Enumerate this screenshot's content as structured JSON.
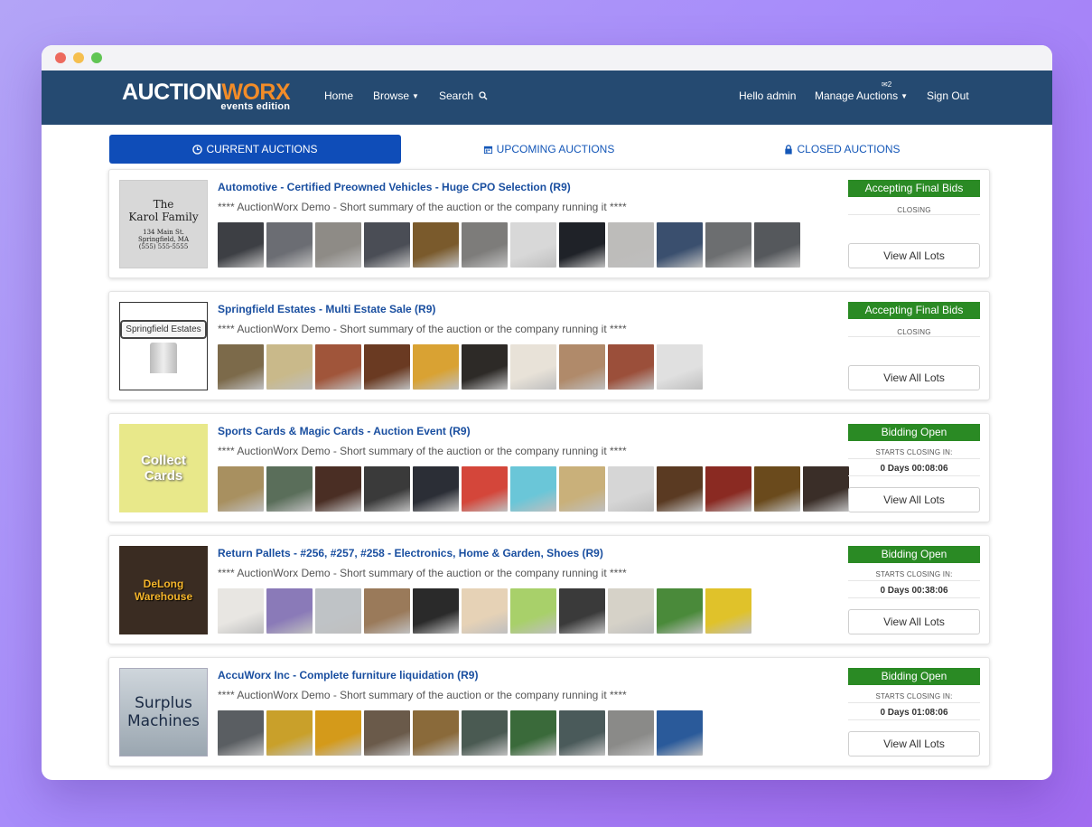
{
  "window_dots": [
    {
      "name": "close",
      "color": "#ed6a5e"
    },
    {
      "name": "minimize",
      "color": "#f5bf4f"
    },
    {
      "name": "maximize",
      "color": "#61c554"
    }
  ],
  "brand": {
    "word1": "AUCTION",
    "word2": "WORX",
    "subtitle": "events edition",
    "colors": {
      "navbar": "#254a71",
      "accent": "#f28c28"
    }
  },
  "nav": {
    "home": "Home",
    "browse": "Browse",
    "search": "Search",
    "greeting": "Hello admin",
    "manage": "Manage Auctions",
    "mail_count": "2",
    "signout": "Sign Out"
  },
  "tabs": {
    "current": "CURRENT AUCTIONS",
    "upcoming": "UPCOMING AUCTIONS",
    "closed": "CLOSED AUCTIONS"
  },
  "auctions": [
    {
      "title": "Automotive - Certified Preowned Vehicles - Huge CPO Selection (R9)",
      "summary": "**** AuctionWorx Demo - Short summary of the auction or the company running it ****",
      "status": "Accepting Final Bids",
      "status_sub": "CLOSING",
      "status_time": "",
      "view": "View All Lots",
      "thumb": {
        "line1": "The",
        "line2": "Karol Family",
        "line3": "134 Main St.",
        "line4": "Springfield, MA",
        "line5": "(555) 555-5555"
      },
      "lots": [
        "#3d3f44",
        "#6b6d73",
        "#8e8b86",
        "#4a4d55",
        "#7a5a2c",
        "#7d7c7a",
        "#d8d8d8",
        "#1f2228",
        "#bdbcba",
        "#3a4f6e",
        "#6c6e70",
        "#55585c"
      ]
    },
    {
      "title": "Springfield Estates - Multi Estate Sale (R9)",
      "summary": "**** AuctionWorx Demo - Short summary of the auction or the company running it ****",
      "status": "Accepting Final Bids",
      "status_sub": "CLOSING",
      "status_time": "",
      "view": "View All Lots",
      "thumb": {
        "line1": "Springfield Estates"
      },
      "lots": [
        "#7c6a4a",
        "#c9b98a",
        "#a0553a",
        "#6a3a22",
        "#d9a233",
        "#2d2a27",
        "#e8e2d8",
        "#b08a6a",
        "#9b4f3a",
        "#e0e0e0"
      ]
    },
    {
      "title": "Sports Cards & Magic Cards - Auction Event (R9)",
      "summary": "**** AuctionWorx Demo - Short summary of the auction or the company running it ****",
      "status": "Bidding Open",
      "status_sub": "STARTS CLOSING IN:",
      "status_time": "0 Days 00:08:06",
      "view": "View All Lots",
      "thumb": {
        "line1": "Collect",
        "line2": "Cards"
      },
      "lots": [
        "#a89060",
        "#5a6e5a",
        "#4a2e24",
        "#3a3a3a",
        "#2b2e36",
        "#d4463a",
        "#6ac6d8",
        "#c9b07a",
        "#d6d6d6",
        "#5a3a22",
        "#8a2a22",
        "#6a4a1c",
        "#3a2e28"
      ]
    },
    {
      "title": "Return Pallets - #256, #257, #258 - Electronics, Home & Garden, Shoes (R9)",
      "summary": "**** AuctionWorx Demo - Short summary of the auction or the company running it ****",
      "status": "Bidding Open",
      "status_sub": "STARTS CLOSING IN:",
      "status_time": "0 Days 00:38:06",
      "view": "View All Lots",
      "thumb": {
        "line1": "DeLong",
        "line2": "Warehouse"
      },
      "lots": [
        "#e8e6e2",
        "#8a7ab8",
        "#bfc3c6",
        "#9a7a5a",
        "#2a2a2a",
        "#e6d2b6",
        "#a8d06a",
        "#3a3a3a",
        "#d6d2c8",
        "#4a8a3a",
        "#e0c22a"
      ]
    },
    {
      "title": "AccuWorx Inc - Complete furniture liquidation (R9)",
      "summary": "**** AuctionWorx Demo - Short summary of the auction or the company running it ****",
      "status": "Bidding Open",
      "status_sub": "STARTS CLOSING IN:",
      "status_time": "0 Days 01:08:06",
      "view": "View All Lots",
      "thumb": {
        "line1": "Surplus",
        "line2": "Machines"
      },
      "lots": [
        "#5a5e62",
        "#c9a02a",
        "#d49a1a",
        "#6a5a4a",
        "#8a6a3a",
        "#4a5a52",
        "#3a6a3a",
        "#4a5a5a",
        "#8a8a88",
        "#2a5a9a"
      ]
    }
  ]
}
